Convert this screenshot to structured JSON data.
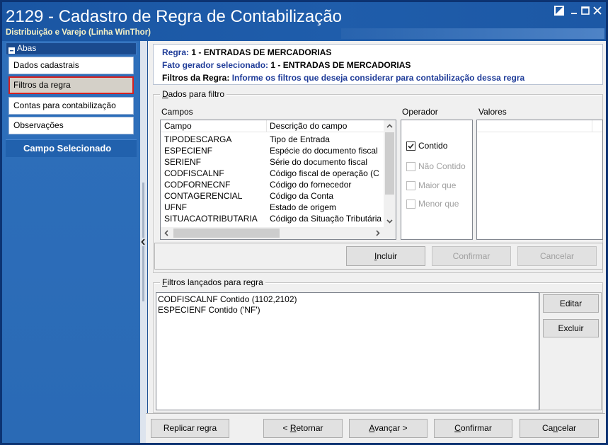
{
  "window": {
    "title": "2129 - Cadastro de Regra de Contabilização",
    "subtitle": "Distribuição e Varejo (Linha WinThor)",
    "controls": [
      "tile-window-icon",
      "minimize-icon",
      "maximize-icon",
      "close-icon"
    ]
  },
  "sidebar": {
    "header": "Abas",
    "header_icon": "collapse-icon",
    "items": [
      {
        "label": "Dados cadastrais",
        "selected": false
      },
      {
        "label": "Filtros da regra",
        "selected": true
      },
      {
        "label": "Contas para contabilização",
        "selected": false
      },
      {
        "label": "Observações",
        "selected": false
      }
    ],
    "section_label": "Campo Selecionado",
    "splitter_icon": "chevron-left-icon"
  },
  "info": {
    "regra_label": "Regra:",
    "regra_value": "1 - ENTRADAS DE MERCADORIAS",
    "fato_label": "Fato gerador selecionado:",
    "fato_value": "1 - ENTRADAS DE MERCADORIAS",
    "filtros_label": "Filtros da Regra:",
    "filtros_value": "Informe os filtros que deseja considerar para contabilização dessa regra"
  },
  "filter_group": {
    "title": "Dados para filtro",
    "title_accel": 0,
    "fields_label": "Campos",
    "columns": {
      "campo": "Campo",
      "descricao": "Descrição do campo"
    },
    "rows": [
      {
        "campo": "TIPODESCARGA",
        "descricao": "Tipo de Entrada"
      },
      {
        "campo": "ESPECIENF",
        "descricao": "Espécie do documento fiscal"
      },
      {
        "campo": "SERIENF",
        "descricao": "Série do documento fiscal"
      },
      {
        "campo": "CODFISCALNF",
        "descricao": "Código fiscal de operação (C"
      },
      {
        "campo": "CODFORNECNF",
        "descricao": "Código do fornecedor"
      },
      {
        "campo": "CONTAGERENCIAL",
        "descricao": "Código da Conta"
      },
      {
        "campo": "UFNF",
        "descricao": "Estado de origem"
      },
      {
        "campo": "SITUACAOTRIBUTARIA",
        "descricao": "Código da Situação Tributária"
      }
    ],
    "operator_label": "Operador",
    "operators": [
      {
        "label": "Contido",
        "checked": true,
        "enabled": true
      },
      {
        "label": "Não Contido",
        "checked": false,
        "enabled": false
      },
      {
        "label": "Maior que",
        "checked": false,
        "enabled": false
      },
      {
        "label": "Menor que",
        "checked": false,
        "enabled": false
      }
    ],
    "values_label": "Valores",
    "buttons": [
      {
        "label": "Incluir",
        "enabled": true,
        "accel": 0
      },
      {
        "label": "Confirmar",
        "enabled": false
      },
      {
        "label": "Cancelar",
        "enabled": false
      }
    ]
  },
  "applied_group": {
    "title": "Filtros lançados para regra",
    "title_accel": 0,
    "lines": [
      "CODFISCALNF Contido (1102,2102)",
      "ESPECIENF Contido ('NF')"
    ],
    "edit_label": "Editar",
    "delete_label": "Excluir"
  },
  "footer": {
    "buttons": [
      {
        "label": "Replicar regra"
      },
      {
        "label": "< Retornar",
        "accel": 2
      },
      {
        "label": "Avançar >",
        "accel": 0
      },
      {
        "label": "Confirmar",
        "accel": 0
      },
      {
        "label": "Cancelar",
        "accel": 2
      }
    ]
  },
  "colors": {
    "title_bar": "#1f5dab",
    "sidebar": "#2a6ab5",
    "selected_tab_border": "#d42020",
    "selected_tab_bg": "#d4d0c8",
    "label_blue": "#1f3c99",
    "disabled_text": "#a0a0a0"
  }
}
